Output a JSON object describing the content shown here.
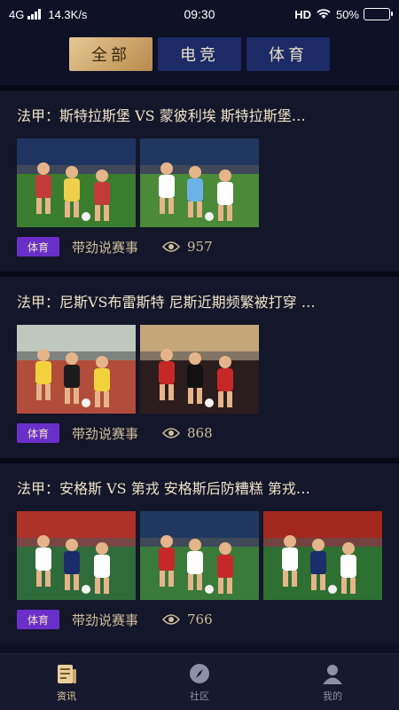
{
  "status": {
    "network": "4G",
    "speed": "14.3K/s",
    "time": "09:30",
    "hd": "HD",
    "battery": "50%",
    "battery_level": 0.5
  },
  "tabs": [
    {
      "label": "全部",
      "active": true
    },
    {
      "label": "电竞",
      "active": false
    },
    {
      "label": "体育",
      "active": false
    }
  ],
  "articles": [
    {
      "title": "法甲：斯特拉斯堡 VS 蒙彼利埃  斯特拉斯堡…",
      "tag": "体育",
      "source": "带劲说赛事",
      "views": "957",
      "thumbs": 2
    },
    {
      "title": "法甲：尼斯VS布雷斯特  尼斯近期频繁被打穿  …",
      "tag": "体育",
      "source": "带劲说赛事",
      "views": "868",
      "thumbs": 2
    },
    {
      "title": "法甲：安格斯 VS 第戎  安格斯后防糟糕 第戎…",
      "tag": "体育",
      "source": "带劲说赛事",
      "views": "766",
      "thumbs": 3
    }
  ],
  "nav": [
    {
      "label": "资讯",
      "icon": "news-icon",
      "active": true
    },
    {
      "label": "社区",
      "icon": "compass-icon",
      "active": false
    },
    {
      "label": "我的",
      "icon": "user-icon",
      "active": false
    }
  ],
  "colors": {
    "background": "#0f1126",
    "accent_gold": "#d4ac6e",
    "tab_blue": "#1c2a66",
    "tag_purple": "#6b2fc9"
  }
}
